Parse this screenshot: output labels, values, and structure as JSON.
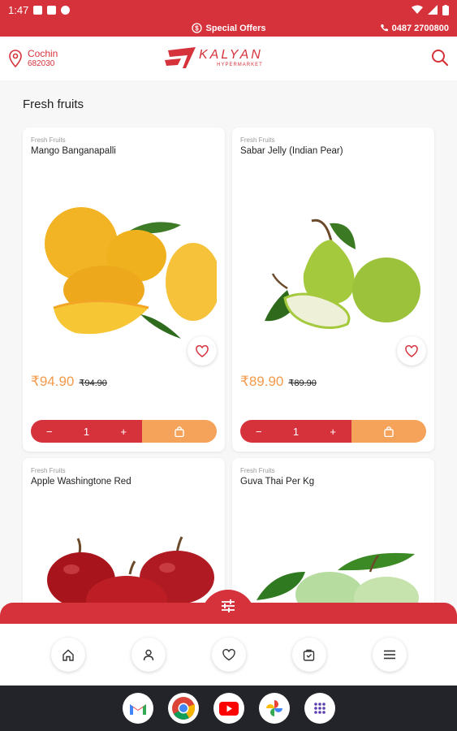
{
  "status": {
    "time": "1:47"
  },
  "offers": {
    "label": "Special Offers",
    "phone": "0487 2700800"
  },
  "location": {
    "city": "Cochin",
    "pincode": "682030"
  },
  "brand": {
    "name": "KALYAN",
    "sub": "HYPERMARKET"
  },
  "section": {
    "title": "Fresh fruits"
  },
  "products": [
    {
      "category": "Fresh Fruits",
      "name": "Mango Banganapalli",
      "price": "₹94.90",
      "mrp": "₹94.90",
      "qty": "1",
      "image": "mango-image"
    },
    {
      "category": "Fresh Fruits",
      "name": "Sabar Jelly (Indian Pear)",
      "price": "₹89.90",
      "mrp": "₹89.90",
      "qty": "1",
      "image": "pear-image"
    },
    {
      "category": "Fresh Fruits",
      "name": "Apple Washingtone Red",
      "image": "apple-image"
    },
    {
      "category": "Fresh Fruits",
      "name": "Guva Thai Per Kg",
      "image": "guava-image"
    }
  ],
  "qty_controls": {
    "minus": "−",
    "plus": "+"
  },
  "nav": [
    "home-icon",
    "profile-icon",
    "wishlist-icon",
    "orders-icon",
    "menu-icon"
  ],
  "colors": {
    "brand": "#d6323b",
    "accent": "#f39a4b",
    "cart": "#f5a25a"
  }
}
